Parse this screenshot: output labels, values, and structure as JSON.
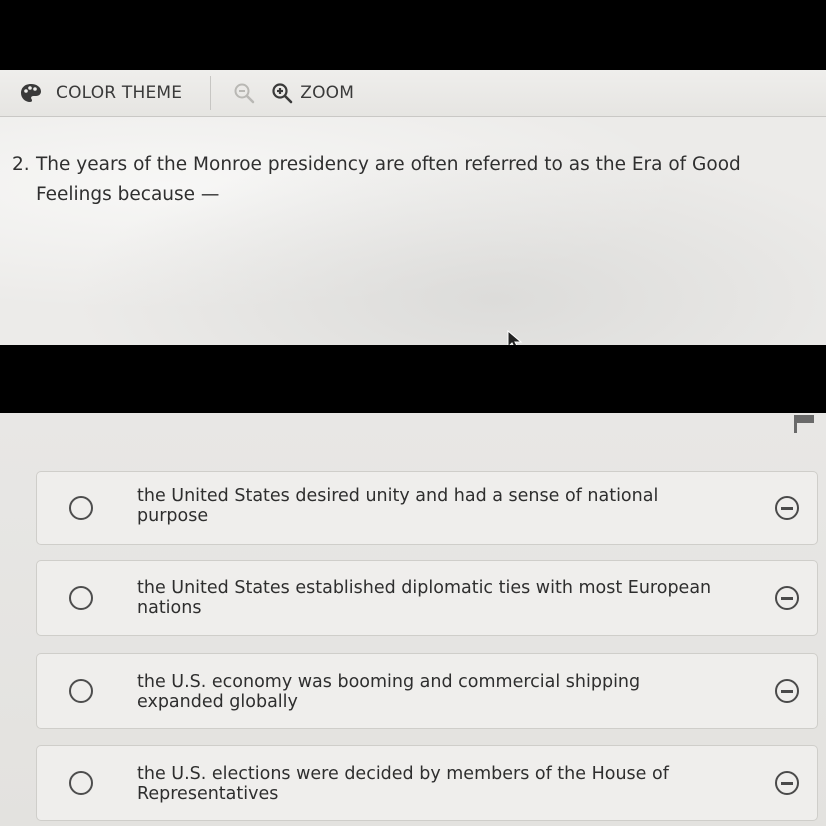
{
  "toolbar": {
    "color_theme_label": "COLOR THEME",
    "zoom_label": "ZOOM"
  },
  "question": {
    "number": "2.",
    "text": "The years of the Monroe presidency are often referred to as the Era of Good Feelings because —"
  },
  "options": [
    {
      "text": "the United States desired unity and had a sense of national purpose"
    },
    {
      "text": "the United States established diplomatic ties with most European nations"
    },
    {
      "text": "the U.S. economy was booming and commercial shipping expanded globally"
    },
    {
      "text": "the U.S. elections were decided by members of the House of Representatives"
    }
  ],
  "icons": {
    "color_theme": "palette-icon",
    "zoom_out": "zoom-out-icon",
    "zoom_in": "zoom-in-icon",
    "flag": "flag-icon",
    "eliminate": "eliminate-icon",
    "radio": "radio-icon"
  }
}
